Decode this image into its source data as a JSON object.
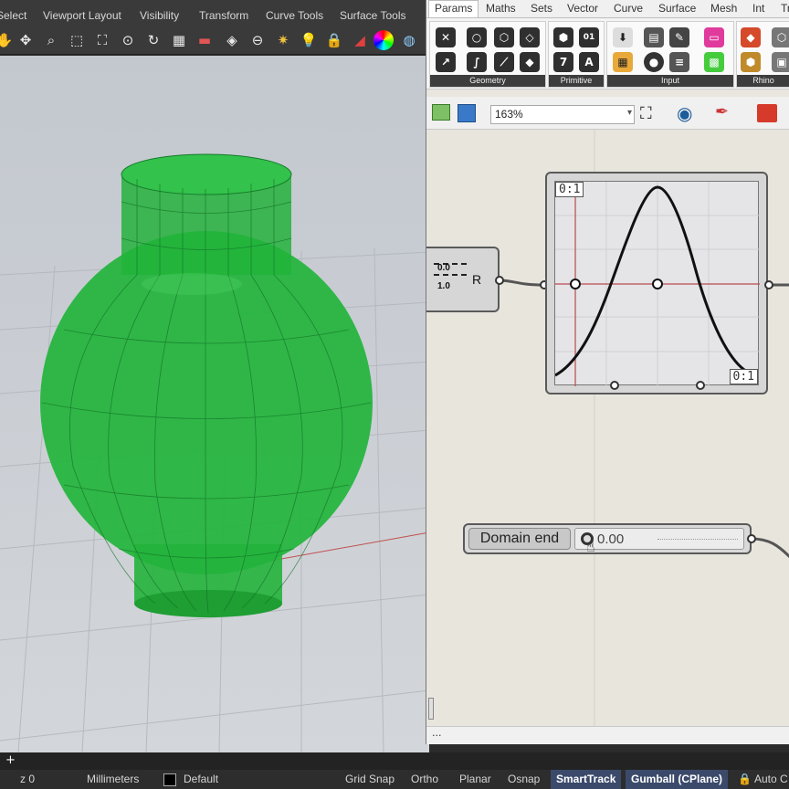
{
  "rhino": {
    "menu_tabs": [
      "Select",
      "Viewport Layout",
      "Visibility",
      "Transform",
      "Curve Tools",
      "Surface Tools"
    ],
    "toolbar_icons": [
      "hand-icon",
      "pan-icon",
      "zoom-icon",
      "zoom-window-icon",
      "zoom-extents-icon",
      "zoom-selected-icon",
      "rotate-view-icon",
      "four-viewports-icon",
      "car-icon",
      "viewport-properties-icon",
      "cplane-icon",
      "sparkle-icon",
      "bulb-icon",
      "lock-icon",
      "paint-icon",
      "color-wheel-icon",
      "globe-icon"
    ],
    "status": {
      "coord": "z 0",
      "units": "Millimeters",
      "layer": "Default",
      "toggles": [
        "Grid Snap",
        "Ortho",
        "Planar",
        "Osnap"
      ],
      "smarttrack": "SmartTrack",
      "gumball": "Gumball (CPlane)",
      "auto": "Auto C"
    },
    "object_color": "#1fb43a"
  },
  "grasshopper": {
    "tabs": [
      "Params",
      "Maths",
      "Sets",
      "Vector",
      "Curve",
      "Surface",
      "Mesh",
      "Int",
      "Tr"
    ],
    "active_tab": "Params",
    "groups": [
      {
        "label": "Geometry"
      },
      {
        "label": "Primitive"
      },
      {
        "label": "Input"
      },
      {
        "label": "Rhino"
      }
    ],
    "primitive_glyphs": [
      "#",
      "01",
      "7",
      "A"
    ],
    "zoom": "163%",
    "graph_mapper": {
      "domain_top": "0:1",
      "domain_bottom": "0:1"
    },
    "rparam": {
      "top": "0.0",
      "bottom": "1.0",
      "label": "R"
    },
    "slider": {
      "label": "Domain end",
      "value": "0.00"
    },
    "footer": "..."
  }
}
